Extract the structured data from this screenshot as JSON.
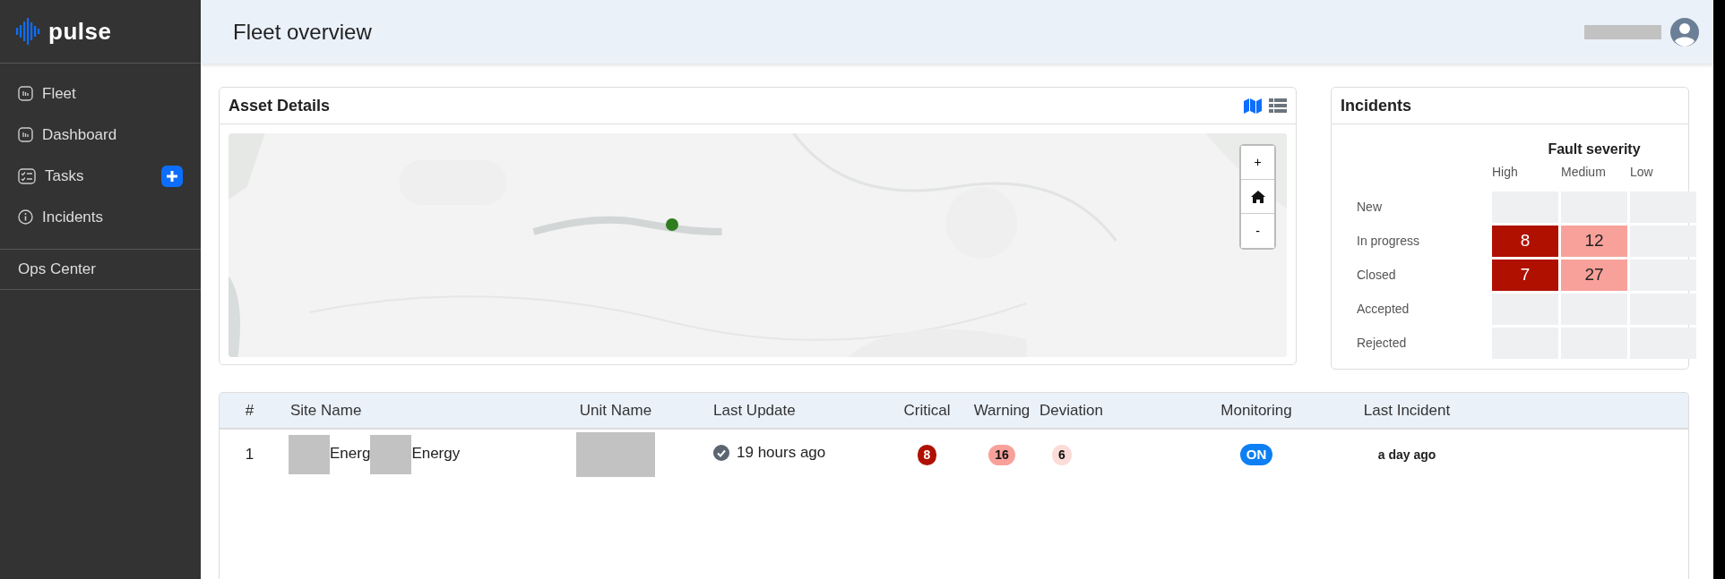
{
  "sidebar": {
    "brand": "pulse",
    "items": [
      {
        "kind": "link",
        "label": "Fleet",
        "add_button": false
      },
      {
        "kind": "link",
        "label": "Dashboard",
        "add_button": false
      },
      {
        "kind": "link",
        "label": "Tasks",
        "add_button": true
      },
      {
        "kind": "link",
        "label": "Incidents",
        "add_button": false
      },
      {
        "kind": "section",
        "label": "Ops Center"
      }
    ]
  },
  "header": {
    "title": "Fleet overview"
  },
  "asset_details": {
    "title": "Asset Details",
    "view_toggle": [
      {
        "kind": "map",
        "selected": true
      },
      {
        "kind": "list",
        "selected": false
      }
    ],
    "map": {
      "kind": "picture",
      "controls": [
        {
          "kind": "zoom_in",
          "label": "+"
        },
        {
          "kind": "home"
        },
        {
          "kind": "zoom_out",
          "label": "-"
        }
      ]
    }
  },
  "incidents": {
    "title": "Incidents",
    "matrix_title": "Fault severity",
    "columns": [
      {
        "label": "High"
      },
      {
        "label": "Medium"
      },
      {
        "label": "Low"
      }
    ],
    "rows": [
      {
        "label": "New",
        "cells": [
          null,
          null,
          null
        ]
      },
      {
        "label": "In progress",
        "cells": [
          {
            "value": "8",
            "color": "#b01000"
          },
          {
            "value": "12",
            "color": "#f8a19a"
          },
          null
        ]
      },
      {
        "label": "Closed",
        "cells": [
          {
            "value": "7",
            "color": "#b01000"
          },
          {
            "value": "27",
            "color": "#f8a19a"
          },
          null
        ]
      },
      {
        "label": "Accepted",
        "cells": [
          null,
          null,
          null
        ]
      },
      {
        "label": "Rejected",
        "cells": [
          null,
          null,
          null
        ]
      }
    ]
  },
  "table": {
    "columns": [
      "#",
      "Site Name",
      "Unit Name",
      "Last Update",
      "Critical",
      "Warning",
      "Deviation",
      "Monitoring",
      "Last Incident"
    ],
    "rows": [
      {
        "number": "1",
        "site_name_parts": [
          "Energ",
          "Energy"
        ],
        "updated": true,
        "last_update": "19 hours ago",
        "critical": "8",
        "warning": "16",
        "deviation": "6",
        "monitoring": "ON",
        "monitoring_on": true,
        "last_incident": "a day ago"
      }
    ]
  }
}
